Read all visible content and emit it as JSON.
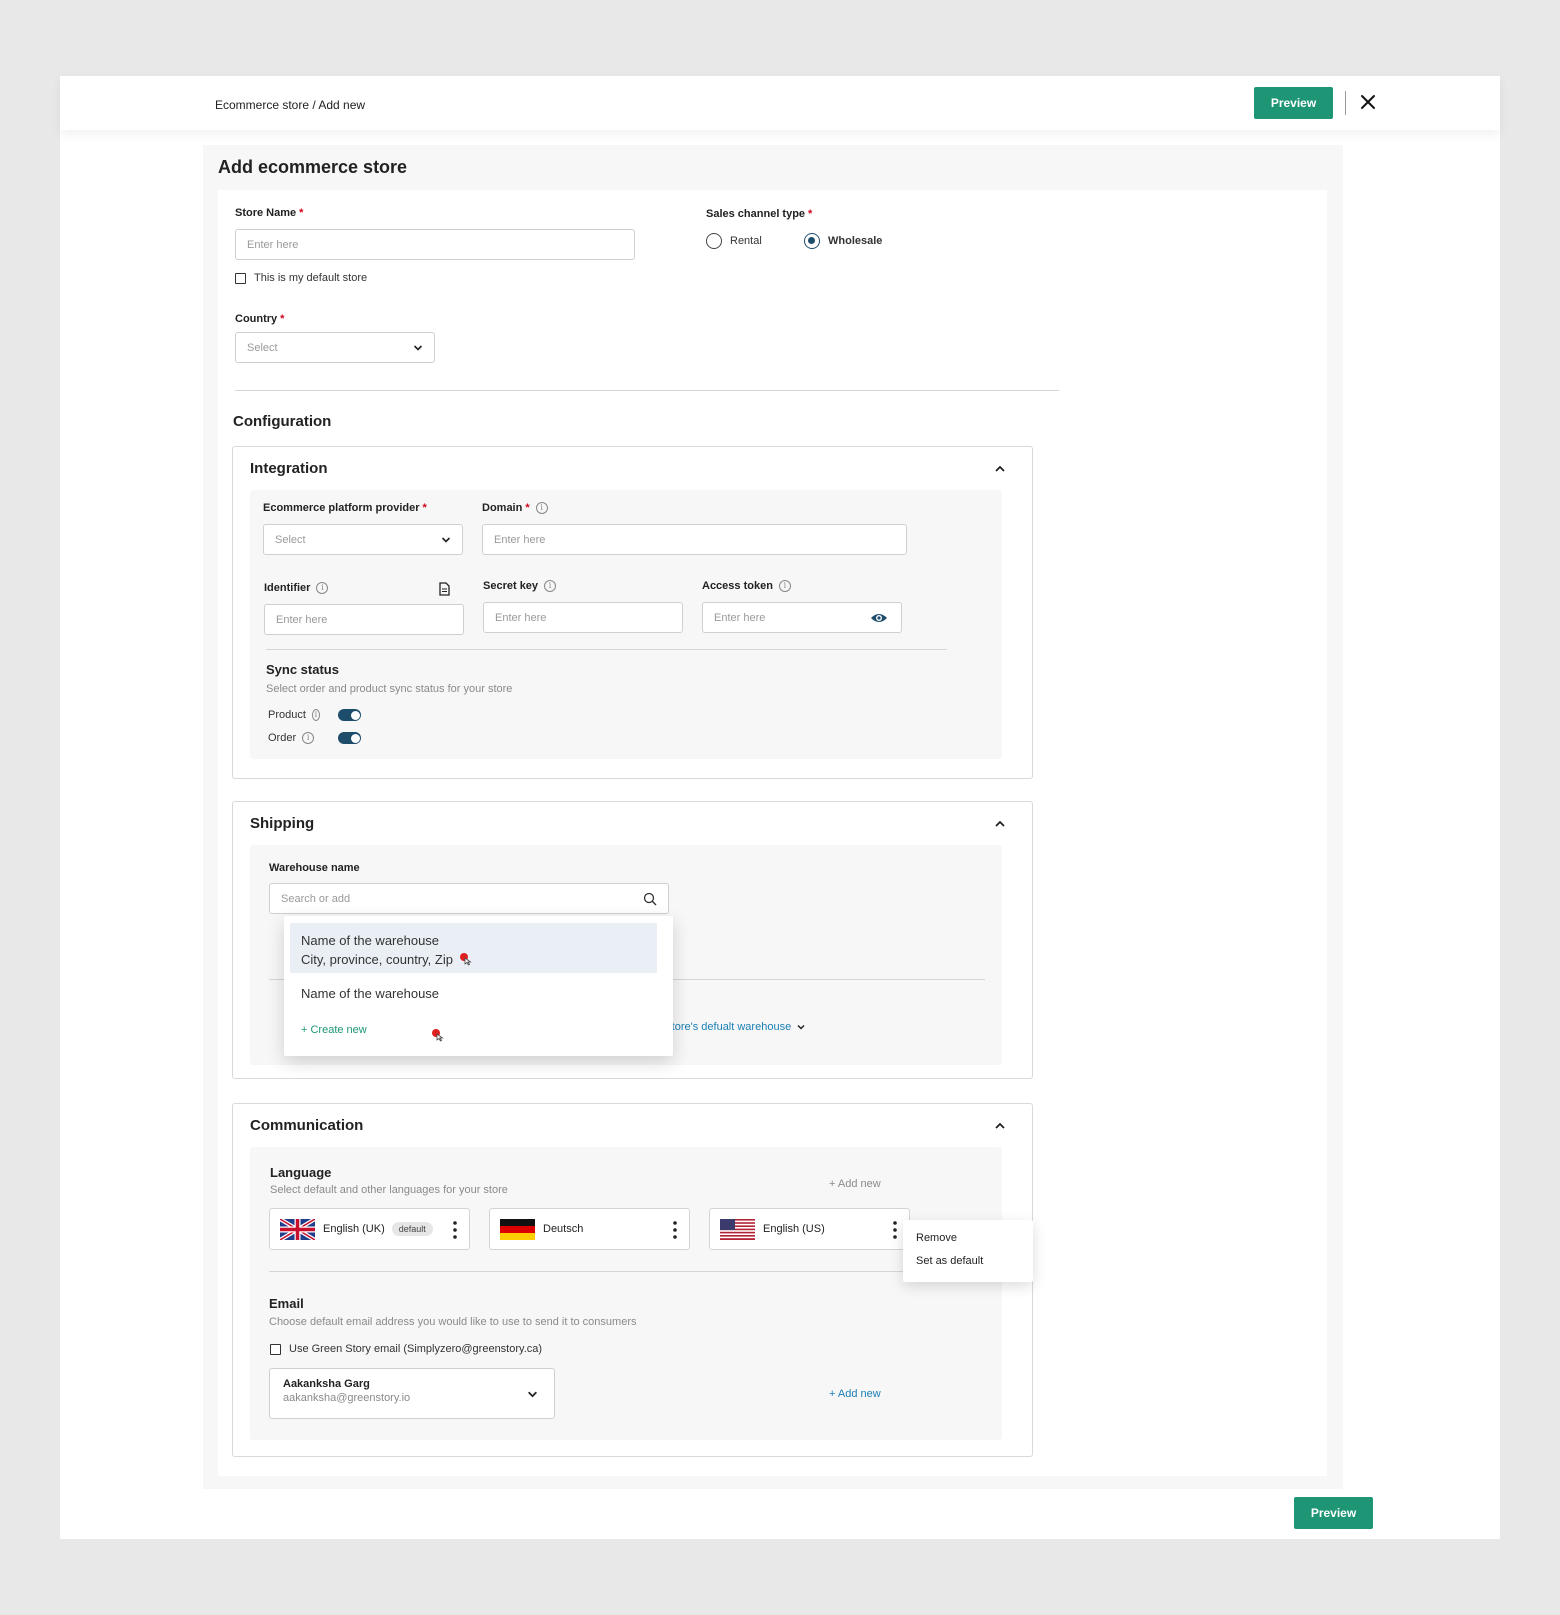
{
  "header": {
    "breadcrumb": "Ecommerce store / Add new",
    "preview_label": "Preview"
  },
  "page": {
    "title": "Add ecommerce store"
  },
  "store": {
    "name_label": "Store Name",
    "name_placeholder": "Enter here",
    "default_checkbox_label": "This is my default store",
    "country_label": "Country",
    "country_value": "Select",
    "sales_channel_label": "Sales channel type",
    "sales_channel_options": [
      "Rental",
      "Wholesale"
    ],
    "sales_channel_selected": "Wholesale"
  },
  "configuration": {
    "title": "Configuration",
    "integration": {
      "title": "Integration",
      "provider_label": "Ecommerce platform provider",
      "provider_value": "Select",
      "domain_label": "Domain",
      "domain_placeholder": "Enter here",
      "identifier_label": "Identifier",
      "identifier_placeholder": "Enter here",
      "secret_label": "Secret key",
      "secret_placeholder": "Enter here",
      "token_label": "Access token",
      "token_placeholder": "Enter here",
      "sync_title": "Sync status",
      "sync_desc": "Select order and product sync status for your store",
      "sync_items": [
        {
          "label": "Product",
          "enabled": true
        },
        {
          "label": "Order",
          "enabled": true
        }
      ]
    },
    "shipping": {
      "title": "Shipping",
      "warehouse_label": "Warehouse name",
      "warehouse_placeholder": "Search or add",
      "options": [
        {
          "name": "Name of the warehouse",
          "address": "City, province, country, Zip"
        },
        {
          "name": "Name of the warehouse"
        }
      ],
      "create_label": "+ Create new",
      "default_link": "e store's defualt warehouse"
    },
    "communication": {
      "title": "Communication",
      "language_title": "Language",
      "language_desc": "Select default and other languages for your store",
      "add_new_label": "+ Add new",
      "languages": [
        {
          "name": "English (UK)",
          "flag": "uk-flag",
          "badge": "default"
        },
        {
          "name": "Deutsch",
          "flag": "germany-flag"
        },
        {
          "name": "English (US)",
          "flag": "us-flag"
        }
      ],
      "context_menu": [
        "Remove",
        "Set as default"
      ],
      "email_title": "Email",
      "email_desc": "Choose default email address you would like to use to send it to consumers",
      "email_checkbox_label": "Use Green Story email (Simplyzero@greenstory.ca)",
      "email_selected_name": "Aakanksha Garg",
      "email_selected_address": "aakanksha@greenstory.io",
      "email_add_new": "+ Add new"
    }
  },
  "colors": {
    "primary_green": "#1e9676",
    "toggle_blue": "#1e4d6b",
    "link_blue": "#1a7fb5",
    "required_red": "#d0021b"
  }
}
